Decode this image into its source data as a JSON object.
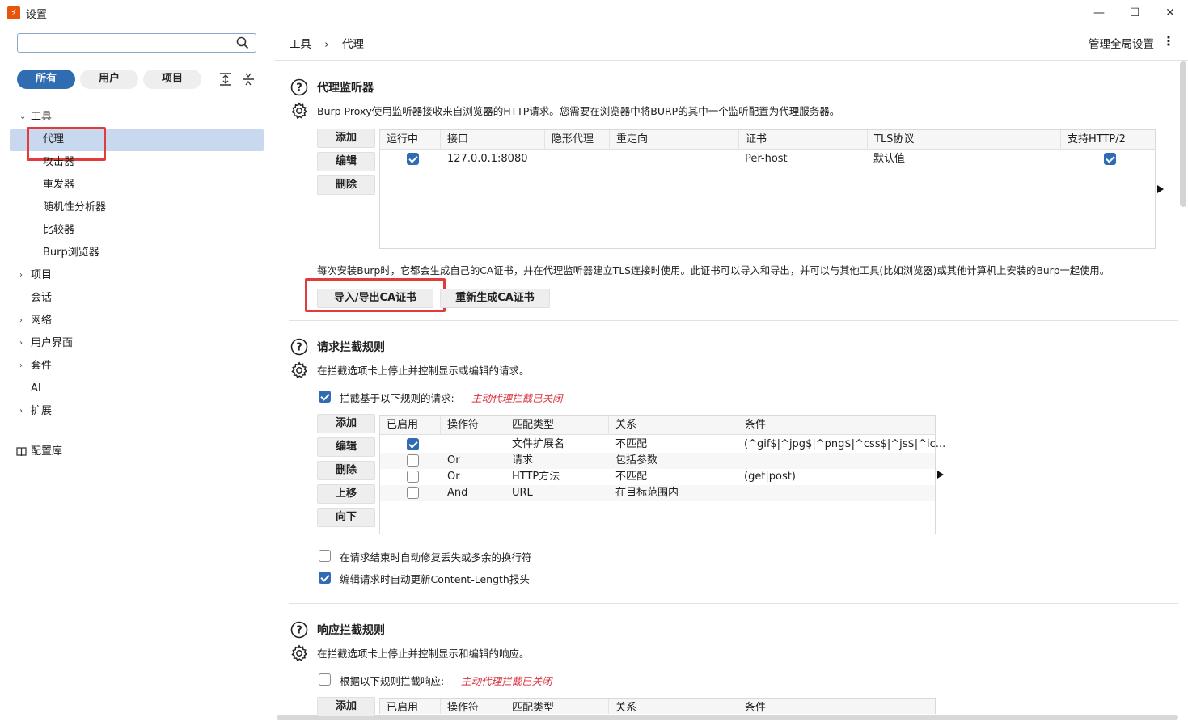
{
  "window": {
    "title": "设置",
    "app_icon_glyph": "⚡",
    "controls": {
      "minimize": "—",
      "maximize": "☐",
      "close": "✕"
    }
  },
  "sidebar": {
    "search": {
      "value": "",
      "placeholder": ""
    },
    "filters": [
      {
        "label": "所有",
        "active": true
      },
      {
        "label": "用户",
        "active": false
      },
      {
        "label": "项目",
        "active": false
      }
    ],
    "tree": {
      "tools": "工具",
      "tools_children": [
        "代理",
        "攻击器",
        "重发器",
        "随机性分析器",
        "比较器",
        "Burp浏览器"
      ],
      "project": "项目",
      "session": "会话",
      "network": "网络",
      "ui": "用户界面",
      "suite": "套件",
      "ai": "AI",
      "extensions": "扩展"
    },
    "config_library": "配置库"
  },
  "header": {
    "breadcrumb_root": "工具",
    "breadcrumb_sep": "›",
    "breadcrumb_current": "代理",
    "manage_global": "管理全局设置",
    "more_glyph": "⋮"
  },
  "listeners": {
    "title": "代理监听器",
    "desc": "Burp Proxy使用监听器接收来自浏览器的HTTP请求。您需要在浏览器中将BURP的其中一个监听配置为代理服务器。",
    "buttons": {
      "add": "添加",
      "edit": "编辑",
      "remove": "删除"
    },
    "columns": [
      "运行中",
      "接口",
      "隐形代理",
      "重定向",
      "证书",
      "TLS协议",
      "支持HTTP/2"
    ],
    "row": {
      "running": true,
      "interface": "127.0.0.1:8080",
      "invisible": "",
      "redirect": "",
      "cert": "Per-host",
      "tls": "默认值",
      "http2": true
    },
    "ca_desc": "每次安装Burp时，它都会生成自己的CA证书，并在代理监听器建立TLS连接时使用。此证书可以导入和导出，并可以与其他工具(比如浏览器)或其他计算机上安装的Burp一起使用。",
    "import_export": "导入/导出CA证书",
    "regenerate": "重新生成CA证书"
  },
  "request_rules": {
    "title": "请求拦截规则",
    "desc": "在拦截选项卡上停止并控制显示或编辑的请求。",
    "enable_label": "拦截基于以下规则的请求:",
    "enable_checked": true,
    "status": "主动代理拦截已关闭",
    "buttons": {
      "add": "添加",
      "edit": "编辑",
      "remove": "删除",
      "up": "上移",
      "down": "向下"
    },
    "columns": [
      "已启用",
      "操作符",
      "匹配类型",
      "关系",
      "条件"
    ],
    "rows": [
      {
        "enabled": true,
        "op": "",
        "match": "文件扩展名",
        "rel": "不匹配",
        "cond": "(^gif$|^jpg$|^png$|^css$|^js$|^ic..."
      },
      {
        "enabled": false,
        "op": "Or",
        "match": "请求",
        "rel": "包括参数",
        "cond": ""
      },
      {
        "enabled": false,
        "op": "Or",
        "match": "HTTP方法",
        "rel": "不匹配",
        "cond": "(get|post)"
      },
      {
        "enabled": false,
        "op": "And",
        "match": "URL",
        "rel": "在目标范围内",
        "cond": ""
      }
    ],
    "auto_fix_label": "在请求结束时自动修复丢失或多余的换行符",
    "auto_fix_checked": false,
    "auto_update_label": "编辑请求时自动更新Content-Length报头",
    "auto_update_checked": true
  },
  "response_rules": {
    "title": "响应拦截规则",
    "desc": "在拦截选项卡上停止并控制显示和编辑的响应。",
    "enable_label": "根据以下规则拦截响应:",
    "enable_checked": false,
    "status": "主动代理拦截已关闭",
    "add": "添加",
    "columns": [
      "已启用",
      "操作符",
      "匹配类型",
      "关系",
      "条件"
    ]
  },
  "colors": {
    "accent": "#2f6cb2",
    "selection": "#c7d8ef",
    "highlight_box": "#e23b3b",
    "status_red": "#d9343f"
  }
}
